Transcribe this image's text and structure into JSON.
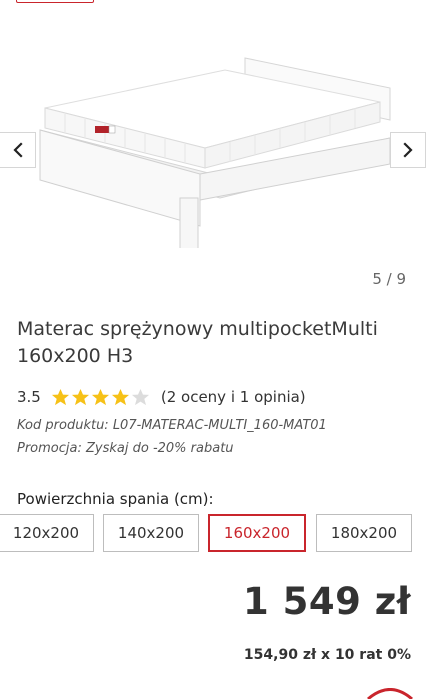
{
  "gallery": {
    "counter": "5 / 9",
    "prev_icon": "chevron-left-icon",
    "next_icon": "chevron-right-icon",
    "badge_icon": "brand-label-icon"
  },
  "product": {
    "title": "Materac sprężynowy multipocketMulti 160x200 H3",
    "rating_value": "3.5",
    "rating_fraction": 0.7,
    "stars_max": 5,
    "reviews_text": "(2 oceny i 1 opinia)",
    "code_text": "Kod produktu: L07-MATERAC-MULTI_160-MAT01",
    "promo_text": "Promocja: Zyskaj do -20% rabatu"
  },
  "size": {
    "label": "Powierzchnia spania (cm):",
    "options": [
      "120x200",
      "140x200",
      "160x200",
      "180x200"
    ],
    "selected": "160x200"
  },
  "price": {
    "main": "1 549 zł",
    "installment": "154,90 zł x 10 rat 0%"
  },
  "colors": {
    "accent": "#c9252c",
    "star_filled": "#f6c117",
    "star_empty": "#dcdcdc",
    "text": "#333333"
  }
}
